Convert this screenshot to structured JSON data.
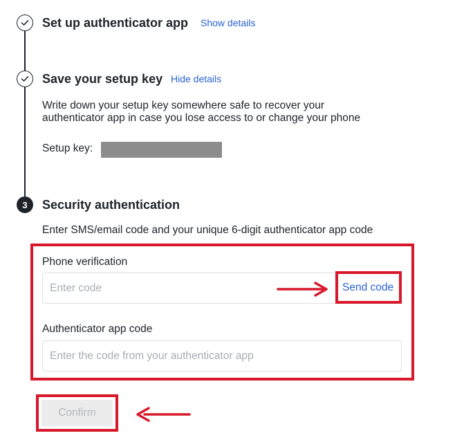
{
  "steps": [
    {
      "status": "done",
      "title": "Set up authenticator app",
      "toggle_label": "Show details"
    },
    {
      "status": "done",
      "title": "Save your setup key",
      "toggle_label": "Hide details",
      "description": "Write down your setup key somewhere safe to recover your authenticator app in case you lose access to or change your phone",
      "setup_key_label": "Setup key:"
    },
    {
      "status": "active",
      "number": "3",
      "title": "Security authentication",
      "instruction": "Enter SMS/email code and your unique 6-digit authenticator app code",
      "phone_verification": {
        "label": "Phone verification",
        "placeholder": "Enter code",
        "send_code_label": "Send code"
      },
      "authenticator_code": {
        "label": "Authenticator app code",
        "placeholder": "Enter the code from your authenticator app"
      },
      "confirm_label": "Confirm"
    }
  ],
  "colors": {
    "text": "#1e2329",
    "link": "#2a63d4",
    "annotation_red": "#d7182a",
    "disabled_button_bg": "#ececec",
    "disabled_button_text": "#b2b5ba",
    "redaction": "#8c8c8c"
  },
  "icons": {
    "done_step": "checkmark-circle-icon",
    "annotation_arrow": "left-pointing-arrow / right-pointing-arrow"
  }
}
